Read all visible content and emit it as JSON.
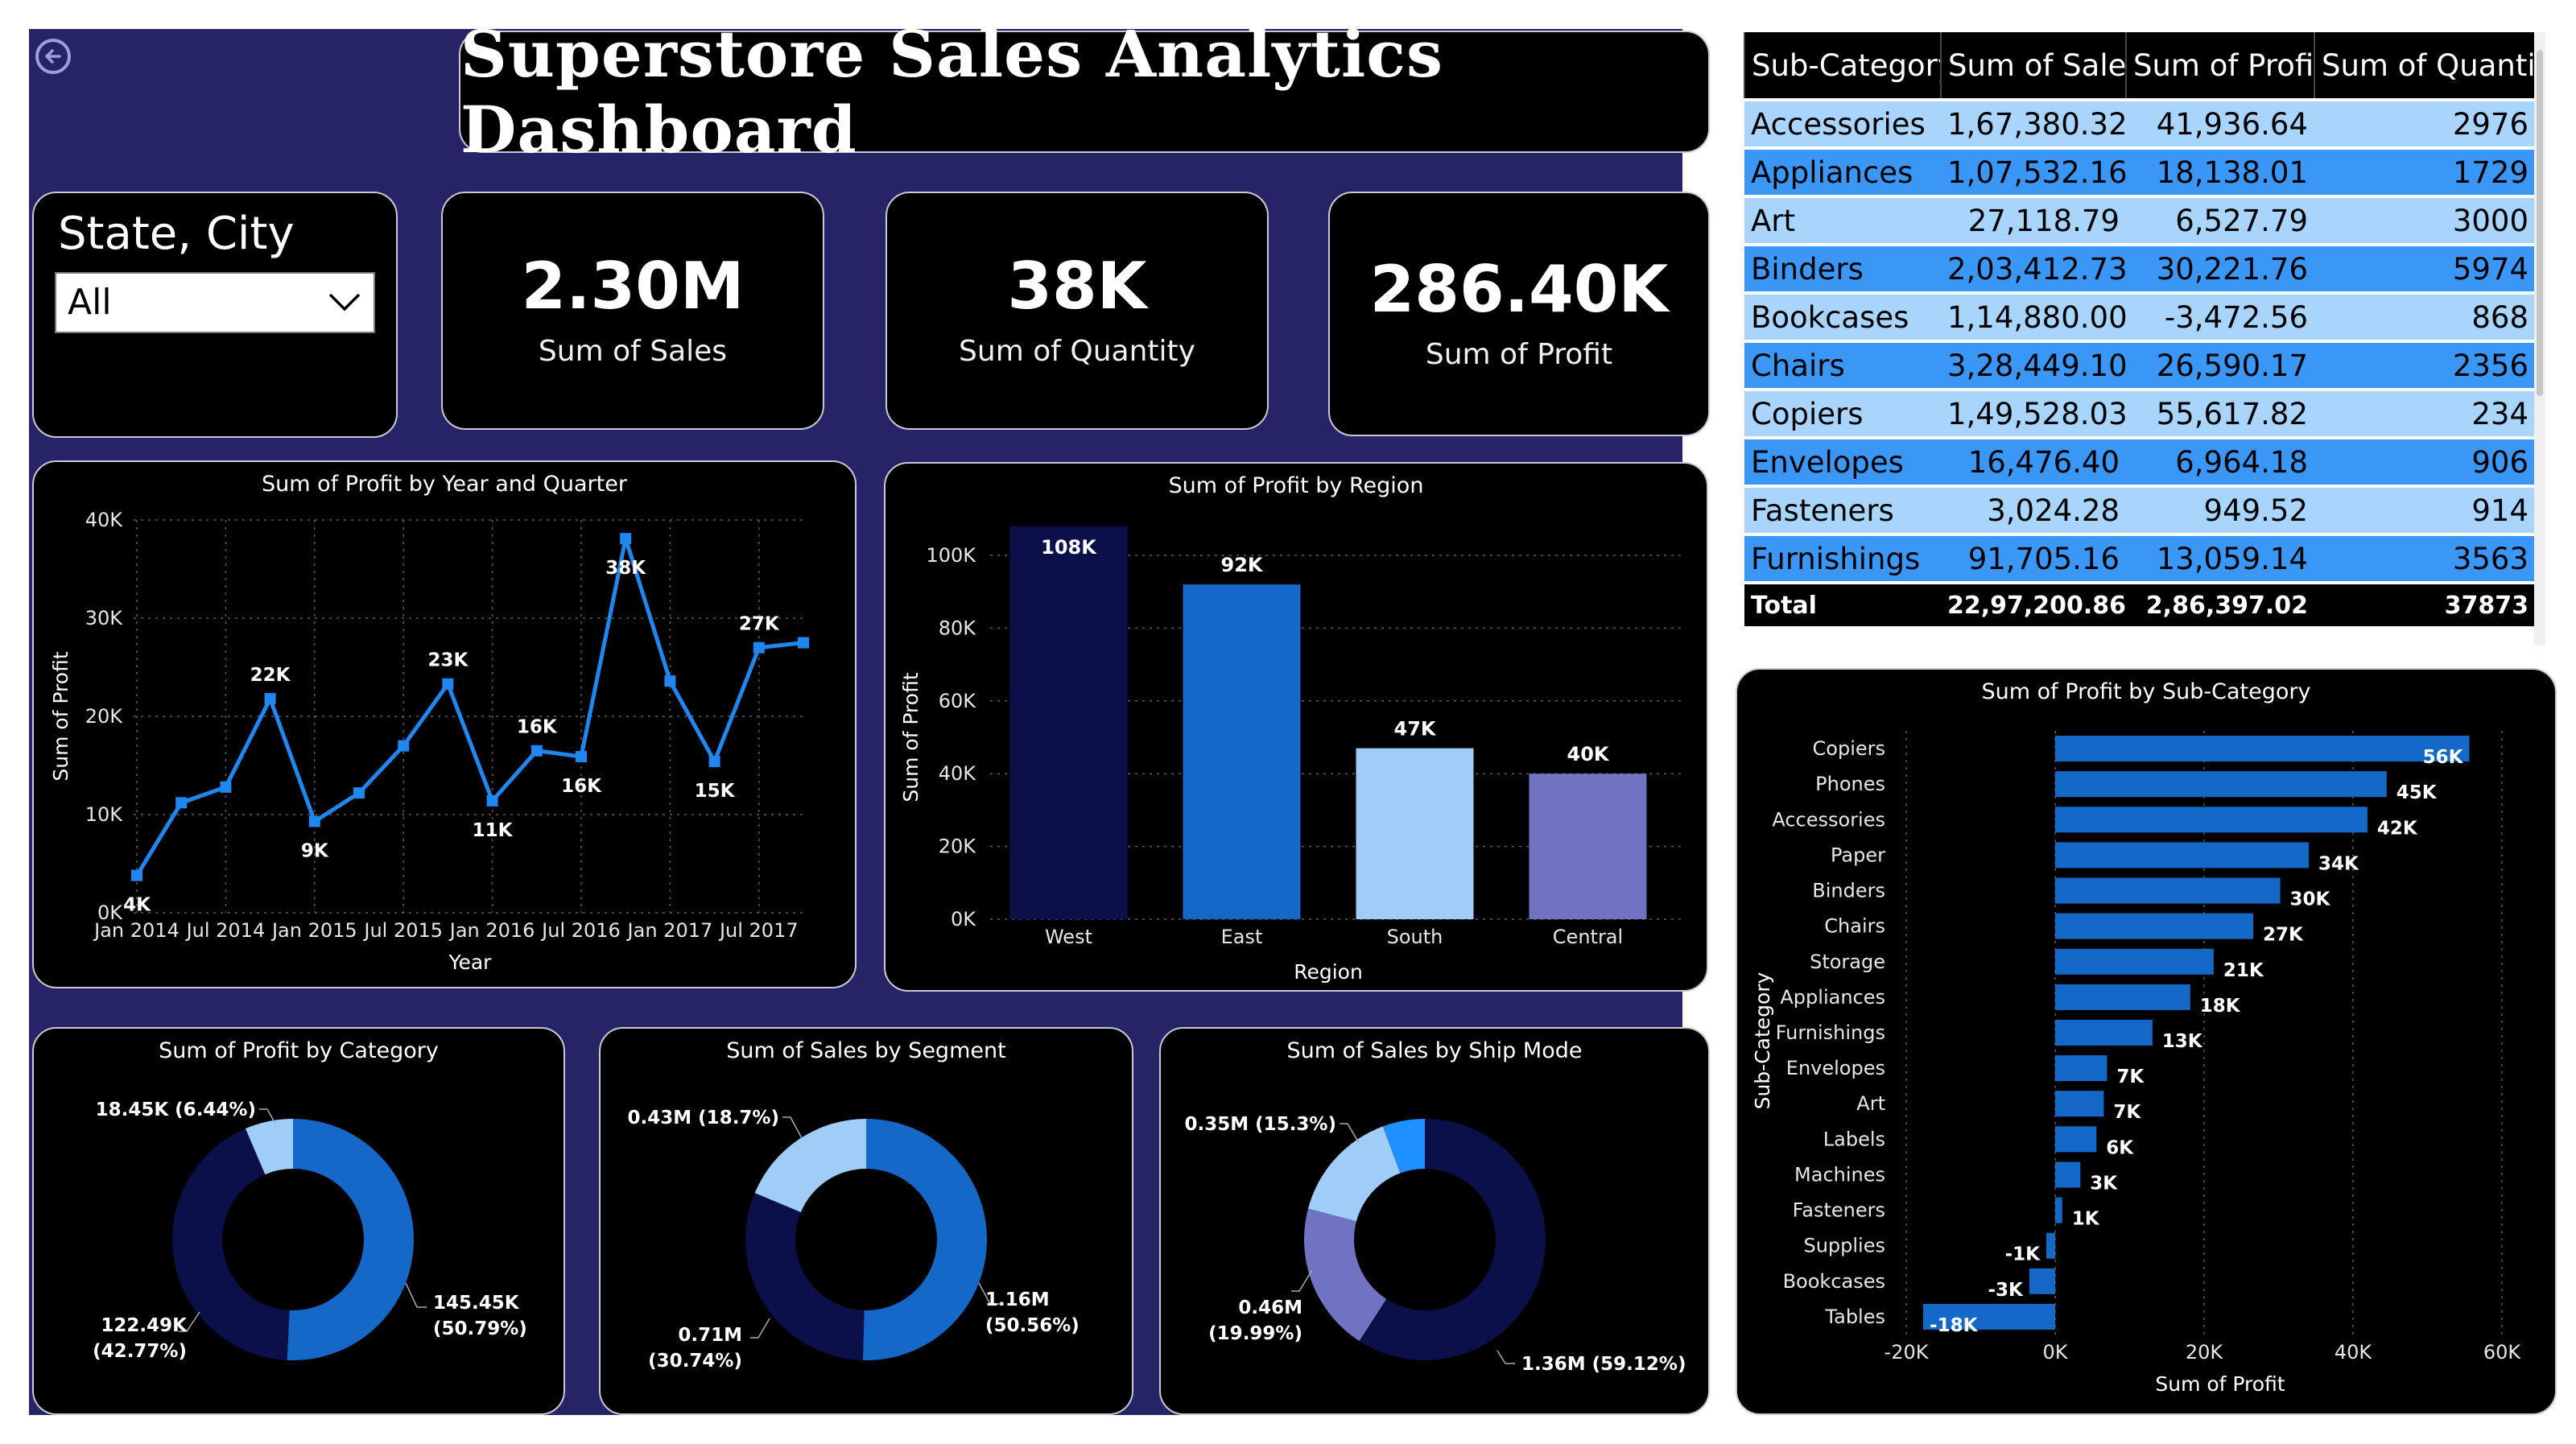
{
  "title": "Superstore Sales Analytics Dashboard",
  "slicer": {
    "title": "State, City",
    "value": "All"
  },
  "kpis": [
    {
      "value": "2.30M",
      "label": "Sum of Sales"
    },
    {
      "value": "38K",
      "label": "Sum of Quantity"
    },
    {
      "value": "286.40K",
      "label": "Sum of Profit"
    }
  ],
  "colors": {
    "canvas": "#262467",
    "card": "#000000",
    "line": "#1f87f0",
    "dark_navy": "#0b0f4a",
    "mid_blue": "#1469c8",
    "light_blue": "#9fcdf7",
    "periwinkle": "#6f73c1",
    "bright_blue": "#1e90ff"
  },
  "table": {
    "headers": [
      "Sub-Category",
      "Sum of Sales",
      "Sum of Profit",
      "Sum of Quantity"
    ],
    "rows": [
      [
        "Accessories",
        "1,67,380.32",
        "41,936.64",
        "2976"
      ],
      [
        "Appliances",
        "1,07,532.16",
        "18,138.01",
        "1729"
      ],
      [
        "Art",
        "27,118.79",
        "6,527.79",
        "3000"
      ],
      [
        "Binders",
        "2,03,412.73",
        "30,221.76",
        "5974"
      ],
      [
        "Bookcases",
        "1,14,880.00",
        "-3,472.56",
        "868"
      ],
      [
        "Chairs",
        "3,28,449.10",
        "26,590.17",
        "2356"
      ],
      [
        "Copiers",
        "1,49,528.03",
        "55,617.82",
        "234"
      ],
      [
        "Envelopes",
        "16,476.40",
        "6,964.18",
        "906"
      ],
      [
        "Fasteners",
        "3,024.28",
        "949.52",
        "914"
      ],
      [
        "Furnishings",
        "91,705.16",
        "13,059.14",
        "3563"
      ]
    ],
    "total": [
      "Total",
      "22,97,200.86",
      "2,86,397.02",
      "37873"
    ]
  },
  "chart_data": [
    {
      "type": "line",
      "title": "Sum of Profit by Year and Quarter",
      "xlabel": "Year",
      "ylabel": "Sum of Profit",
      "x_ticks": [
        "Jan 2014",
        "Jul 2014",
        "Jan 2015",
        "Jul 2015",
        "Jan 2016",
        "Jul 2016",
        "Jan 2017",
        "Jul 2017"
      ],
      "y_ticks": [
        "0K",
        "10K",
        "20K",
        "30K",
        "40K"
      ],
      "ylim": [
        0,
        40000
      ],
      "x": [
        "2014 Q1",
        "2014 Q2",
        "2014 Q3",
        "2014 Q4",
        "2015 Q1",
        "2015 Q2",
        "2015 Q3",
        "2015 Q4",
        "2016 Q1",
        "2016 Q2",
        "2016 Q3",
        "2016 Q4",
        "2017 Q1",
        "2017 Q2",
        "2017 Q3",
        "2017 Q4"
      ],
      "values": [
        3800,
        11200,
        12800,
        21800,
        9300,
        12200,
        17000,
        23300,
        11400,
        16500,
        15900,
        38100,
        23600,
        15400,
        27000,
        27500
      ],
      "data_labels": [
        {
          "i": 0,
          "text": "4K",
          "pos": "below"
        },
        {
          "i": 3,
          "text": "22K",
          "pos": "above"
        },
        {
          "i": 4,
          "text": "9K",
          "pos": "below"
        },
        {
          "i": 7,
          "text": "23K",
          "pos": "above"
        },
        {
          "i": 8,
          "text": "11K",
          "pos": "below"
        },
        {
          "i": 9,
          "text": "16K",
          "pos": "above"
        },
        {
          "i": 10,
          "text": "16K",
          "pos": "below"
        },
        {
          "i": 11,
          "text": "38K",
          "pos": "below"
        },
        {
          "i": 13,
          "text": "15K",
          "pos": "below"
        },
        {
          "i": 14,
          "text": "27K",
          "pos": "above"
        }
      ],
      "grid": true
    },
    {
      "type": "bar",
      "title": "Sum of Profit by Region",
      "xlabel": "Region",
      "ylabel": "Sum of Profit",
      "categories": [
        "West",
        "East",
        "South",
        "Central"
      ],
      "values": [
        108000,
        92000,
        47000,
        40000
      ],
      "data_labels": [
        "108K",
        "92K",
        "47K",
        "40K"
      ],
      "bar_colors": [
        "#0b0f4a",
        "#1469c8",
        "#9fcdf7",
        "#6f73c1"
      ],
      "y_ticks": [
        "0K",
        "20K",
        "40K",
        "60K",
        "80K",
        "100K"
      ],
      "ylim": [
        0,
        100000
      ],
      "grid": true
    },
    {
      "type": "pie",
      "title": "Sum of Profit by Category",
      "values": [
        145450,
        122490,
        18450
      ],
      "labels": [
        "145.45K (50.79%)",
        "122.49K (42.77%)",
        "18.45K (6.44%)"
      ],
      "colors": [
        "#1469c8",
        "#0b0f4a",
        "#9fcdf7"
      ]
    },
    {
      "type": "pie",
      "title": "Sum of Sales by Segment",
      "values": [
        1160000,
        710000,
        430000
      ],
      "labels": [
        "1.16M (50.56%)",
        "0.71M (30.74%)",
        "0.43M (18.7%)"
      ],
      "colors": [
        "#1469c8",
        "#0b0f4a",
        "#9fcdf7"
      ]
    },
    {
      "type": "pie",
      "title": "Sum of Sales by Ship Mode",
      "values": [
        1360000,
        460000,
        350000,
        130000
      ],
      "labels": [
        "1.36M (59.12%)",
        "0.46M (19.99%)",
        "0.35M (15.3%)",
        ""
      ],
      "colors": [
        "#0b0f4a",
        "#6f73c1",
        "#9fcdf7",
        "#1e90ff"
      ]
    },
    {
      "type": "bar",
      "orientation": "horizontal",
      "title": "Sum of Profit by Sub-Category",
      "xlabel": "Sum of Profit",
      "ylabel": "Sub-Category",
      "categories": [
        "Copiers",
        "Phones",
        "Accessories",
        "Paper",
        "Binders",
        "Chairs",
        "Storage",
        "Appliances",
        "Furnishings",
        "Envelopes",
        "Art",
        "Labels",
        "Machines",
        "Fasteners",
        "Supplies",
        "Bookcases",
        "Tables"
      ],
      "values": [
        55618,
        44516,
        41937,
        34054,
        30222,
        26590,
        21279,
        18138,
        13059,
        6964,
        6528,
        5546,
        3385,
        950,
        -1189,
        -3473,
        -17725
      ],
      "data_labels": [
        "56K",
        "45K",
        "42K",
        "34K",
        "30K",
        "27K",
        "21K",
        "18K",
        "13K",
        "7K",
        "7K",
        "6K",
        "3K",
        "1K",
        "-1K",
        "-3K",
        "-18K"
      ],
      "x_ticks": [
        "-20K",
        "0K",
        "20K",
        "40K",
        "60K"
      ],
      "xlim": [
        -20000,
        60000
      ],
      "color": "#1469c8",
      "grid": true
    }
  ]
}
